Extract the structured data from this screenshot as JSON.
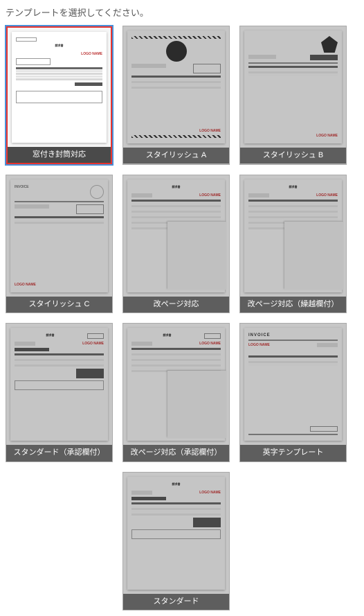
{
  "header": "テンプレートを選択してください。",
  "templates": [
    {
      "id": "window-envelope",
      "label": "窓付き封筒対応",
      "selected": true
    },
    {
      "id": "stylish-a",
      "label": "スタイリッシュ A",
      "selected": false
    },
    {
      "id": "stylish-b",
      "label": "スタイリッシュ B",
      "selected": false
    },
    {
      "id": "stylish-c",
      "label": "スタイリッシュ C",
      "selected": false
    },
    {
      "id": "page-break",
      "label": "改ページ対応",
      "selected": false
    },
    {
      "id": "page-break-carryover",
      "label": "改ページ対応（繰越欄付）",
      "selected": false
    },
    {
      "id": "standard-approval",
      "label": "スタンダード（承認欄付）",
      "selected": false
    },
    {
      "id": "page-break-approval",
      "label": "改ページ対応（承認欄付）",
      "selected": false
    },
    {
      "id": "english",
      "label": "英字テンプレート",
      "selected": false
    },
    {
      "id": "standard",
      "label": "スタンダード",
      "selected": false
    }
  ],
  "doc_text": {
    "invoice_jp": "請求書",
    "invoice_en": "INVOICE",
    "logo": "LOGO NAME"
  }
}
